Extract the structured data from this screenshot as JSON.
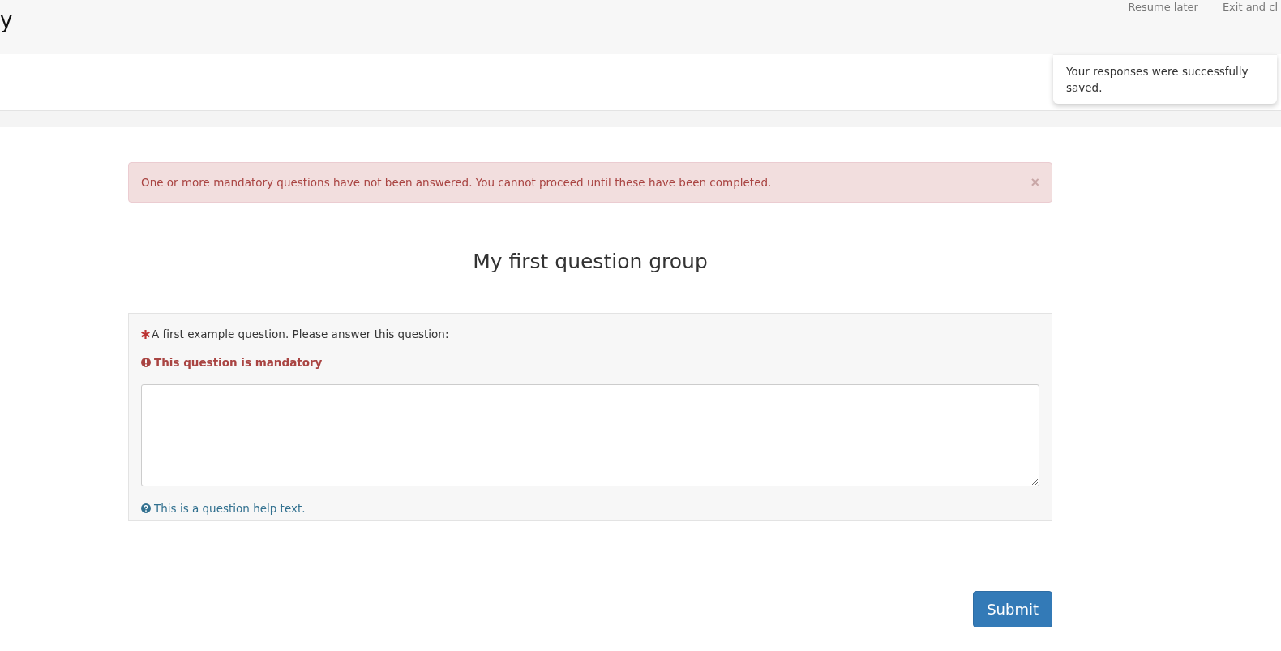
{
  "header": {
    "title": "y",
    "links": [
      {
        "label": "Resume later"
      },
      {
        "label": "Exit and cl"
      }
    ]
  },
  "toast": {
    "message": "Your responses were successfully saved."
  },
  "alert": {
    "message": "One or more mandatory questions have not been answered. You cannot proceed until these have been completed.",
    "close": "×"
  },
  "group_title": "My first question group",
  "question": {
    "mandatory": true,
    "text": "A first example question. Please answer this question:",
    "error": "This question is mandatory",
    "help": "This is a question help text."
  },
  "submit": "Submit"
}
